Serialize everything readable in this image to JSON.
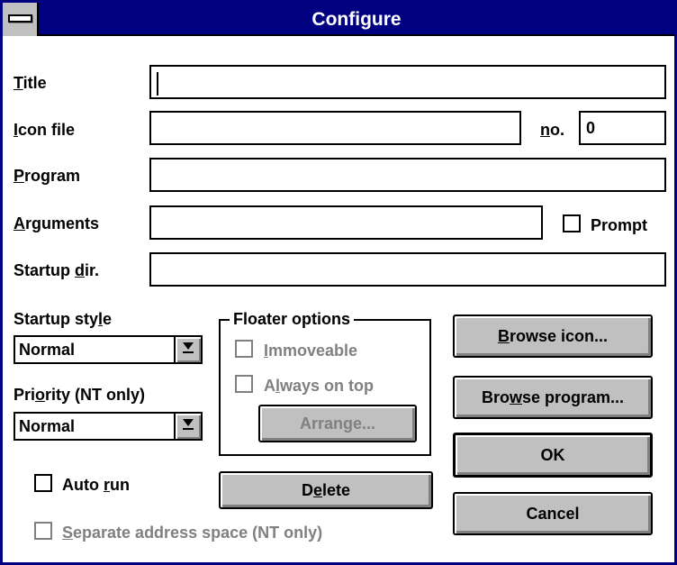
{
  "window": {
    "title": "Configure"
  },
  "fields": {
    "title": {
      "label_pre": "",
      "label_key": "T",
      "label_post": "itle",
      "value": ""
    },
    "icon_file": {
      "label_pre": "",
      "label_key": "I",
      "label_post": "con file",
      "value": ""
    },
    "icon_no": {
      "label_pre": "",
      "label_key": "n",
      "label_post": "o.",
      "value": "0"
    },
    "program": {
      "label_pre": "",
      "label_key": "P",
      "label_post": "rogram",
      "value": ""
    },
    "arguments": {
      "label_pre": "",
      "label_key": "A",
      "label_post": "rguments",
      "value": ""
    },
    "startup_dir": {
      "label_pre": "Startup ",
      "label_key": "d",
      "label_post": "ir.",
      "value": ""
    }
  },
  "prompt": {
    "label": "Prompt",
    "checked": false
  },
  "startup_style": {
    "label_pre": "Startup sty",
    "label_key": "l",
    "label_post": "e",
    "value": "Normal"
  },
  "priority": {
    "label_pre": "Pri",
    "label_key": "o",
    "label_post": "rity (NT only)",
    "value": "Normal"
  },
  "floater": {
    "title": "Floater options",
    "immoveable": {
      "label_pre": "",
      "label_key": "I",
      "label_post": "mmoveable",
      "enabled": false
    },
    "always_on_top": {
      "label_pre": "A",
      "label_key": "l",
      "label_post": "ways on top",
      "enabled": false
    },
    "arrange": {
      "label_pre": "Arran",
      "label_key": "g",
      "label_post": "e...",
      "enabled": false
    }
  },
  "auto_run": {
    "label_pre": "Auto ",
    "label_key": "r",
    "label_post": "un",
    "checked": false
  },
  "separate_space": {
    "label_pre": "",
    "label_key": "S",
    "label_post": "eparate address space (NT only)",
    "enabled": false
  },
  "buttons": {
    "delete": {
      "label_pre": "D",
      "label_key": "e",
      "label_post": "lete"
    },
    "browse_icon": {
      "label_pre": "",
      "label_key": "B",
      "label_post": "rowse icon..."
    },
    "browse_program": {
      "label_pre": "Bro",
      "label_key": "w",
      "label_post": "se program..."
    },
    "ok": {
      "label": "OK"
    },
    "cancel": {
      "label": "Cancel"
    }
  },
  "colors": {
    "titlebar": "#000080",
    "face": "#c0c0c0",
    "disabled": "#808080"
  }
}
